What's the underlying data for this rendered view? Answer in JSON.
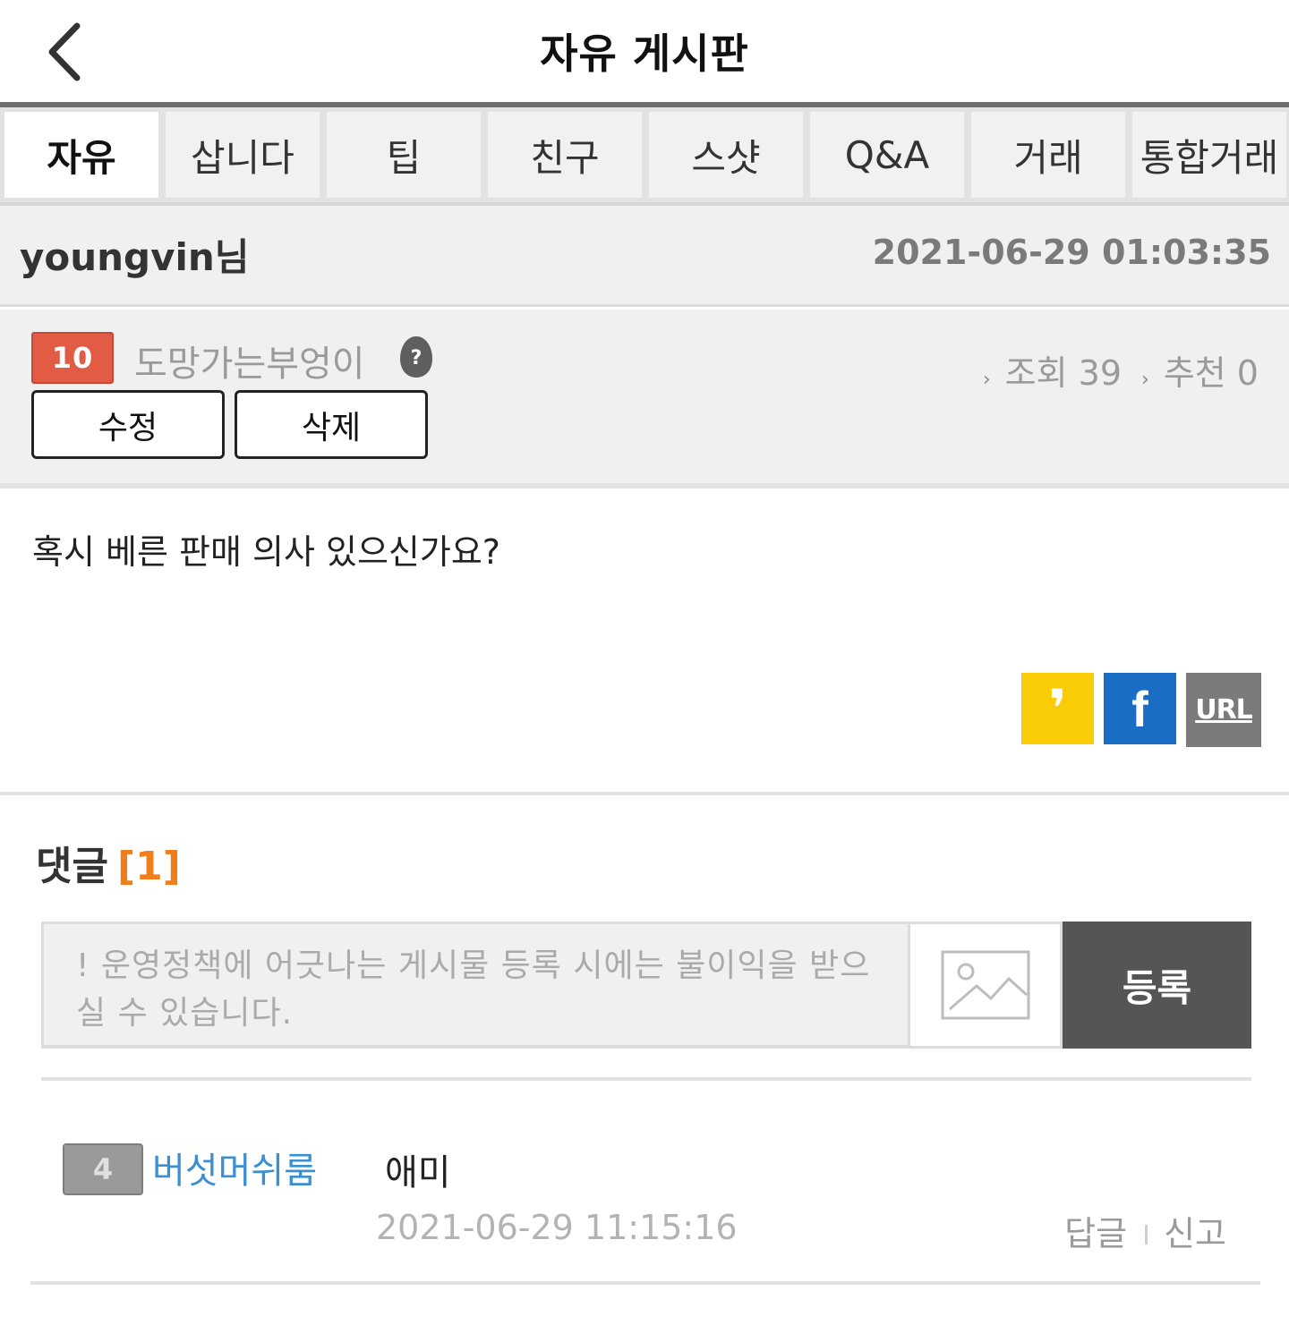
{
  "header": {
    "title": "자유 게시판",
    "back_icon": "chevron-left-icon"
  },
  "tabs": [
    {
      "label": "자유",
      "active": true
    },
    {
      "label": "삽니다",
      "active": false
    },
    {
      "label": "팁",
      "active": false
    },
    {
      "label": "친구",
      "active": false
    },
    {
      "label": "스샷",
      "active": false
    },
    {
      "label": "Q&A",
      "active": false
    },
    {
      "label": "거래",
      "active": false
    },
    {
      "label": "통합거래",
      "active": false
    }
  ],
  "post": {
    "username": "youngvin님",
    "date": "2021-06-29 01:03:35",
    "level": "10",
    "nickname": "도망가는부엉이",
    "edit_label": "수정",
    "delete_label": "삭제",
    "views_label": "조회 39",
    "likes_label": "추천 0",
    "body": "혹시 베른 판매 의사 있으신가요?"
  },
  "share": {
    "kakao_glyph": "❜",
    "facebook_glyph": "f",
    "url_label": "URL"
  },
  "comments": {
    "title": "댓글",
    "count": "[1]",
    "input_placeholder": "! 운영정책에 어긋나는 게시물 등록 시에는 불이익을 받으실 수 있습니다.",
    "submit_label": "등록",
    "items": [
      {
        "level": "4",
        "author": "버섯머쉬룸",
        "text": "애미",
        "date": "2021-06-29 11:15:16",
        "reply_label": "답글",
        "report_label": "신고"
      }
    ]
  },
  "colors": {
    "accent_orange": "#f07f1b",
    "level_red": "#e25b45",
    "kakao_yellow": "#f9cc05",
    "facebook_blue": "#1a6dc5",
    "author_blue": "#3b8fd0"
  }
}
